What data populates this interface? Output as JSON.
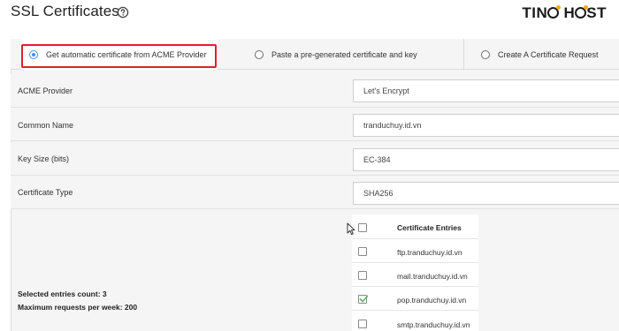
{
  "page": {
    "title": "SSL Certificates",
    "brand_text_left": "TIN",
    "brand_text_right": "H",
    "brand_text_end": "ST"
  },
  "tabs": [
    {
      "label": "Get automatic certificate from ACME Provider",
      "selected": true
    },
    {
      "label": "Paste a pre-generated certificate and key",
      "selected": false
    },
    {
      "label": "Create A Certificate Request",
      "selected": false
    }
  ],
  "fields": [
    {
      "label": "ACME Provider",
      "value": "Let's Encrypt"
    },
    {
      "label": "Common Name",
      "value": "tranduchuy.id.vn"
    },
    {
      "label": "Key Size (bits)",
      "value": "EC-384"
    },
    {
      "label": "Certificate Type",
      "value": "SHA256"
    }
  ],
  "summary": {
    "selected_count": "Selected entries count: 3",
    "max_requests": "Maximum requests per week: 200"
  },
  "certificate_entries": {
    "header": "Certificate Entries",
    "items": [
      {
        "name": "ftp.tranduchuy.id.vn",
        "checked": false
      },
      {
        "name": "mail.tranduchuy.id.vn",
        "checked": false
      },
      {
        "name": "pop.tranduchuy.id.vn",
        "checked": true
      },
      {
        "name": "smtp.tranduchuy.id.vn",
        "checked": false
      }
    ]
  },
  "colors": {
    "accent": "#4a90e2",
    "highlight": "#e0202a",
    "check": "#5cb85c",
    "brand_dot": "#f5a623"
  }
}
